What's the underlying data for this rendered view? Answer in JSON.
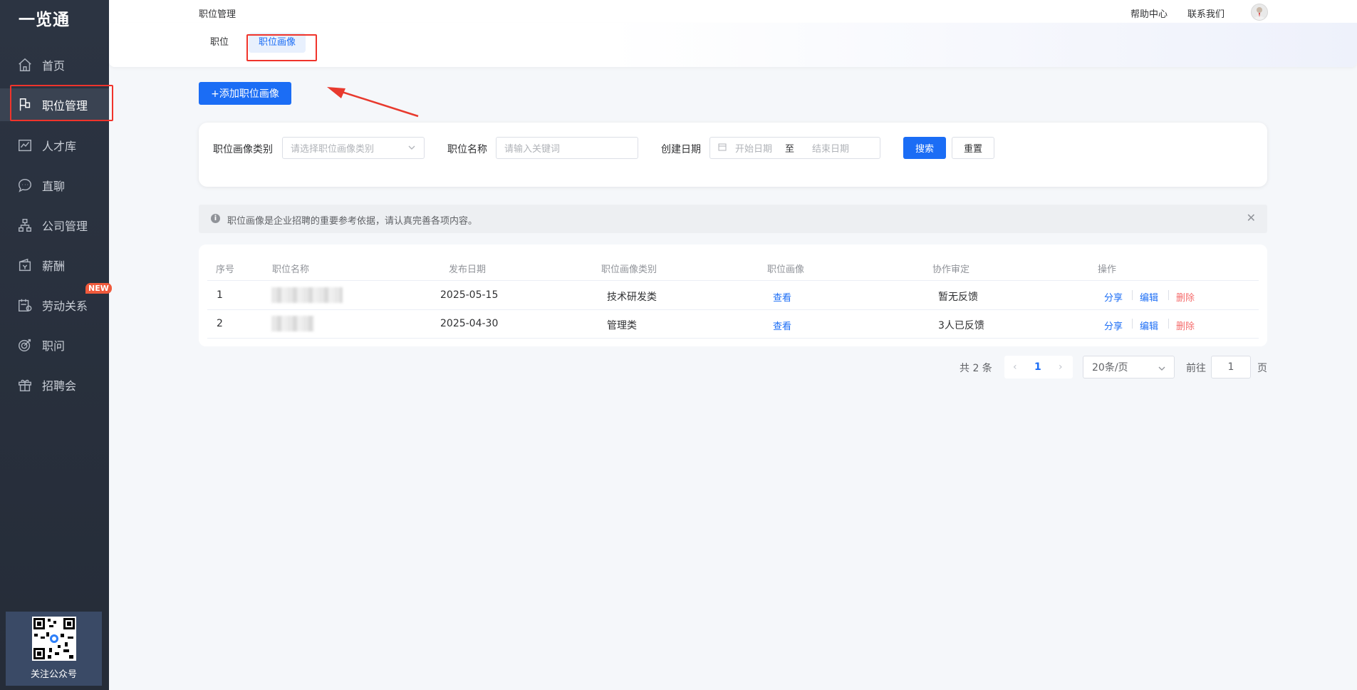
{
  "app": {
    "logo": "一览通"
  },
  "sidebar": {
    "items": [
      {
        "label": "首页",
        "icon": "home-icon"
      },
      {
        "label": "职位管理",
        "icon": "flag-icon",
        "active": true
      },
      {
        "label": "人才库",
        "icon": "chart-line-icon"
      },
      {
        "label": "直聊",
        "icon": "chat-icon"
      },
      {
        "label": "公司管理",
        "icon": "org-chart-icon"
      },
      {
        "label": "薪酬",
        "icon": "wallet-icon"
      },
      {
        "label": "劳动关系",
        "icon": "contract-icon",
        "badge": "NEW"
      },
      {
        "label": "职问",
        "icon": "target-icon"
      },
      {
        "label": "招聘会",
        "icon": "gift-icon"
      }
    ],
    "qr_label": "关注公众号"
  },
  "header": {
    "title": "职位管理",
    "help": "帮助中心",
    "contact": "联系我们"
  },
  "tabs": [
    {
      "label": "职位",
      "active": false
    },
    {
      "label": "职位画像",
      "active": true
    }
  ],
  "add_button": "+添加职位画像",
  "filters": {
    "category_label": "职位画像类别",
    "category_placeholder": "请选择职位画像类别",
    "name_label": "职位名称",
    "name_placeholder": "请输入关键词",
    "date_label": "创建日期",
    "start_placeholder": "开始日期",
    "range_sep": "至",
    "end_placeholder": "结束日期",
    "search": "搜索",
    "reset": "重置"
  },
  "alert": {
    "message": "职位画像是企业招聘的重要参考依据，请认真完善各项内容。"
  },
  "table": {
    "columns": [
      "序号",
      "职位名称",
      "发布日期",
      "职位画像类别",
      "职位画像",
      "协作审定",
      "操作"
    ],
    "rows": [
      {
        "index": "1",
        "date": "2025-05-15",
        "category": "技术研发类",
        "view": "查看",
        "review": "暂无反馈",
        "share": "分享",
        "edit": "编辑",
        "delete": "删除"
      },
      {
        "index": "2",
        "date": "2025-04-30",
        "category": "管理类",
        "view": "查看",
        "review": "3人已反馈",
        "share": "分享",
        "edit": "编辑",
        "delete": "删除"
      }
    ]
  },
  "pagination": {
    "total": "共 2 条",
    "current_page": "1",
    "page_size": "20条/页",
    "goto_label": "前往",
    "goto_value": "1",
    "page_suffix": "页"
  },
  "colors": {
    "primary": "#1b6df5",
    "danger": "#f56c6c",
    "sidebar": "#2c3442",
    "highlight": "#f0342b"
  }
}
